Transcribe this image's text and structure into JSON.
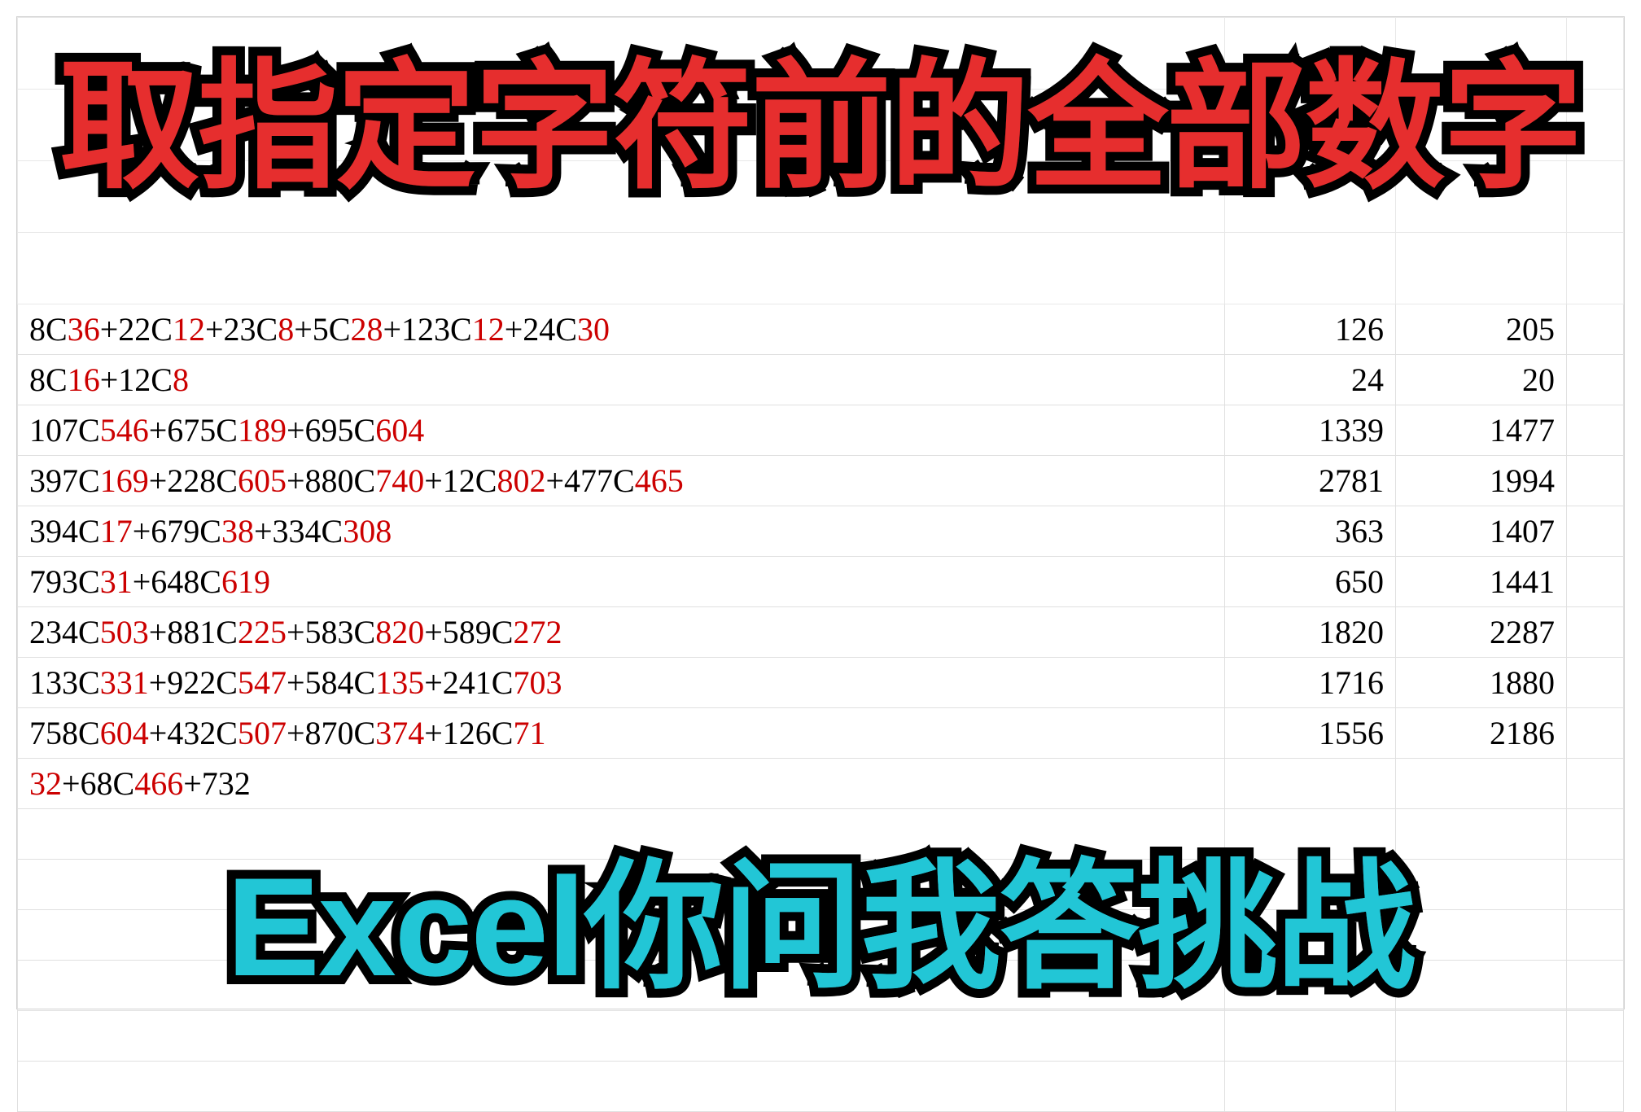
{
  "title": "取指定字符前的全部数字",
  "subtitle": "Excel你问我答挑战",
  "rows": [
    {
      "segments": [
        {
          "b": "8C",
          "r": "36"
        },
        {
          "b": "+22C",
          "r": "12"
        },
        {
          "b": "+23C",
          "r": "8"
        },
        {
          "b": "+5C",
          "r": "28"
        },
        {
          "b": "+123C",
          "r": "12"
        },
        {
          "b": "+24C",
          "r": "30"
        }
      ],
      "col1": "126",
      "col2": "205"
    },
    {
      "segments": [
        {
          "b": "8C",
          "r": "16"
        },
        {
          "b": "+12C",
          "r": "8"
        }
      ],
      "col1": "24",
      "col2": "20"
    },
    {
      "segments": [
        {
          "b": "107C",
          "r": "546"
        },
        {
          "b": "+675C",
          "r": "189"
        },
        {
          "b": "+695C",
          "r": "604"
        }
      ],
      "col1": "1339",
      "col2": "1477"
    },
    {
      "segments": [
        {
          "b": "397C",
          "r": "169"
        },
        {
          "b": "+228C",
          "r": "605"
        },
        {
          "b": "+880C",
          "r": "740"
        },
        {
          "b": "+12C",
          "r": "802"
        },
        {
          "b": "+477C",
          "r": "465"
        }
      ],
      "col1": "2781",
      "col2": "1994"
    },
    {
      "segments": [
        {
          "b": "394C",
          "r": "17"
        },
        {
          "b": "+679C",
          "r": "38"
        },
        {
          "b": "+334C",
          "r": "308"
        }
      ],
      "col1": "363",
      "col2": "1407"
    },
    {
      "segments": [
        {
          "b": "793C",
          "r": "31"
        },
        {
          "b": "+648C",
          "r": "619"
        }
      ],
      "col1": "650",
      "col2": "1441"
    },
    {
      "segments": [
        {
          "b": "234C",
          "r": "503"
        },
        {
          "b": "+881C",
          "r": "225"
        },
        {
          "b": "+583C",
          "r": "820"
        },
        {
          "b": "+589C",
          "r": "272"
        }
      ],
      "col1": "1820",
      "col2": "2287"
    },
    {
      "segments": [
        {
          "b": "133C",
          "r": "331"
        },
        {
          "b": "+922C",
          "r": "547"
        },
        {
          "b": "+584C",
          "r": "135"
        },
        {
          "b": "+241C",
          "r": "703"
        }
      ],
      "col1": "1716",
      "col2": "1880"
    },
    {
      "segments": [
        {
          "b": "758C",
          "r": "604"
        },
        {
          "b": "+432C",
          "r": "507"
        },
        {
          "b": "+870C",
          "r": "374"
        },
        {
          "b": "+126C",
          "r": "71"
        }
      ],
      "col1": "1556",
      "col2": "2186"
    },
    {
      "segments": [
        {
          "b": "",
          "r": "32"
        },
        {
          "b": "+68C",
          "r": "466"
        },
        {
          "b": "+732",
          "r": ""
        }
      ],
      "col1": "",
      "col2": ""
    }
  ]
}
